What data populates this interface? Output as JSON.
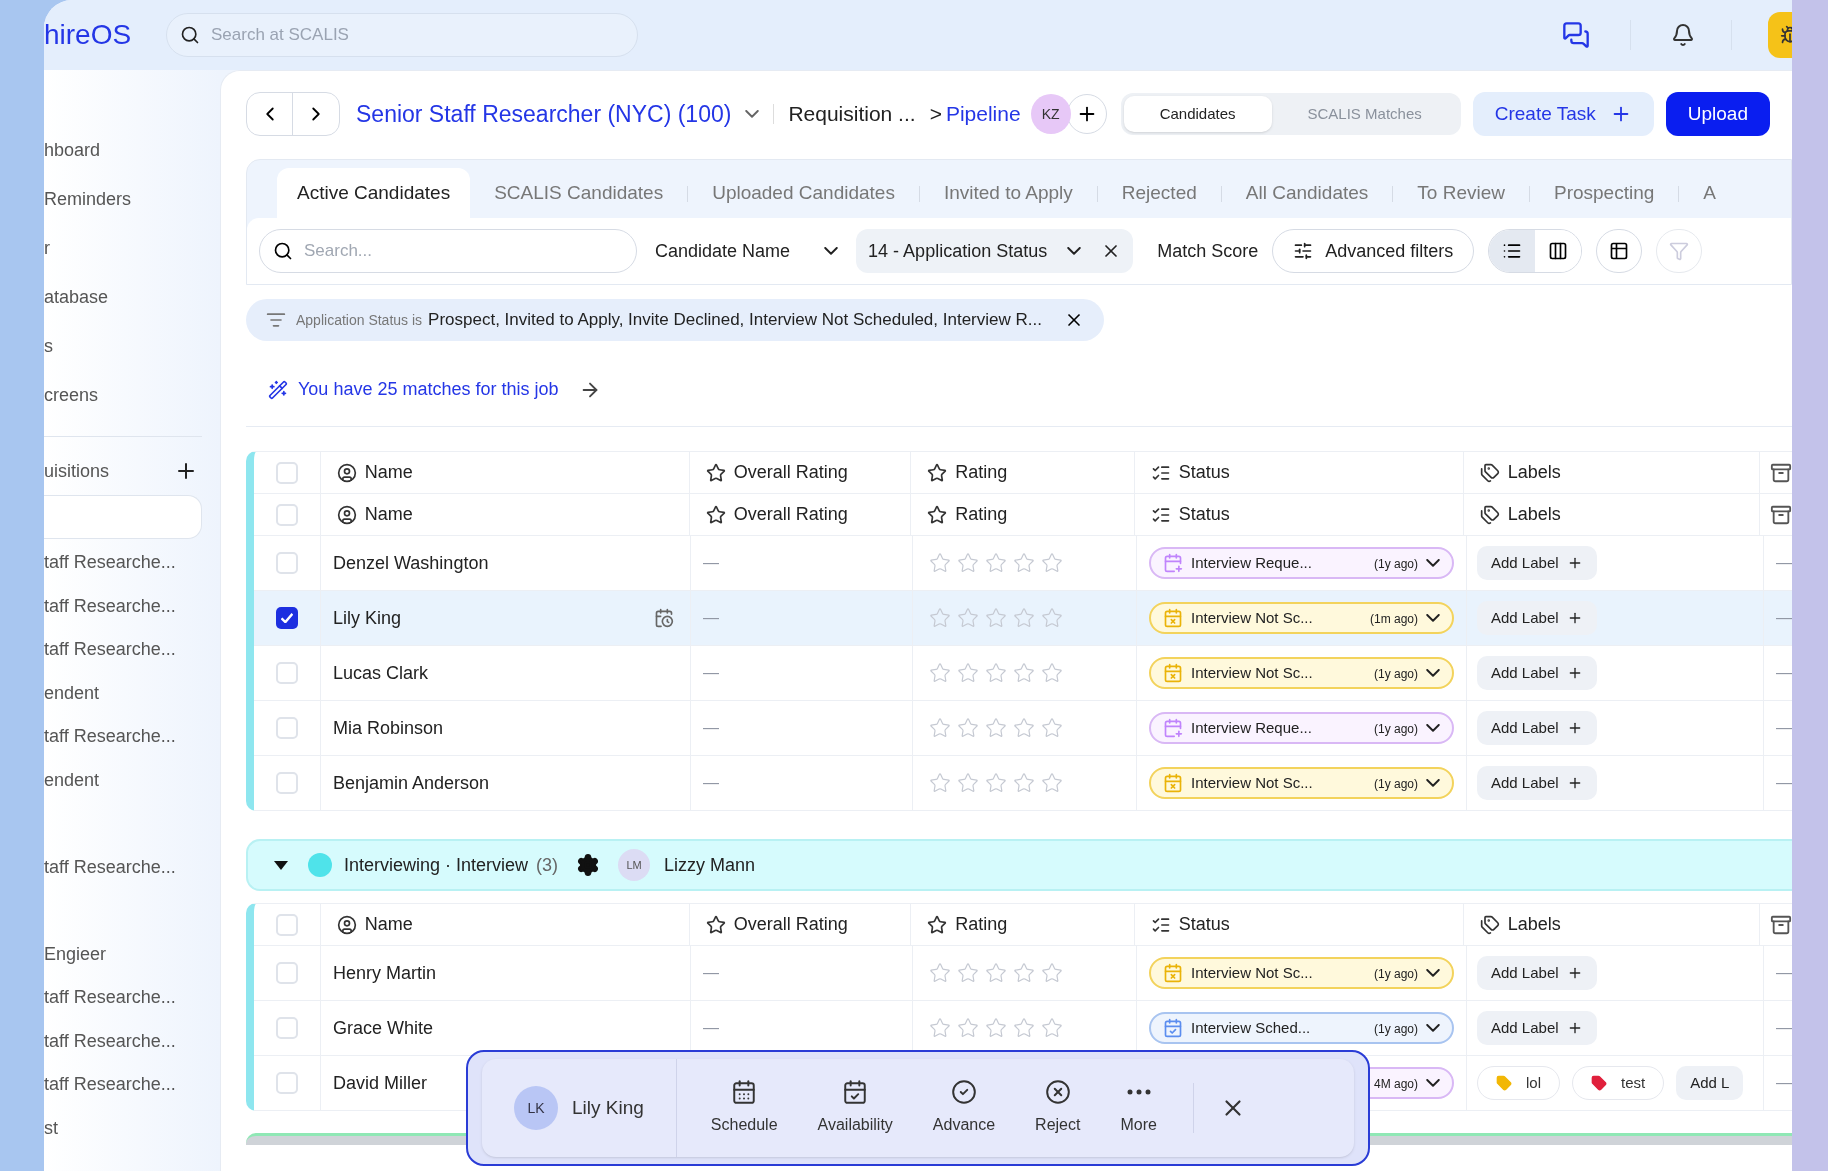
{
  "app": {
    "logo": "hireOS",
    "search_placeholder": "Search at SCALIS"
  },
  "sidebar": {
    "nav": [
      "hboard",
      "Reminders",
      "r",
      "atabase",
      "s",
      "creens"
    ],
    "requisitions_title": "uisitions",
    "requisitions": [
      {
        "label": "taff Researche...",
        "selected": false
      },
      {
        "label": "taff Researche...",
        "selected": false
      },
      {
        "label": "taff Researche...",
        "selected": false
      },
      {
        "label": "endent",
        "selected": false
      },
      {
        "label": "taff Researche...",
        "selected": false
      },
      {
        "label": "endent",
        "selected": false
      },
      {
        "selected": false
      },
      {
        "label": "taff Researche...",
        "selected": false
      },
      {
        "selected": false
      },
      {
        "label": "Engieer",
        "selected": false
      },
      {
        "label": "taff Researche...",
        "selected": false
      },
      {
        "label": "taff Researche...",
        "selected": false
      },
      {
        "label": "taff Researche...",
        "selected": false
      },
      {
        "label": "st",
        "selected": false
      }
    ]
  },
  "breadcrumb": {
    "job": "Senior Staff Researcher (NYC) (100)",
    "requisition": "Requisition ...",
    "separator": ">",
    "page": "Pipeline",
    "avatar": "KZ"
  },
  "view_toggle": [
    {
      "label": "Candidates",
      "selected": true
    },
    {
      "label": "SCALIS Matches",
      "selected": false
    }
  ],
  "create_task": "Create Task",
  "upload": "Upload",
  "tabs": [
    {
      "label": "Active Candidates",
      "selected": true
    },
    {
      "label": "SCALIS Candidates",
      "selected": false
    },
    {
      "label": "Uploaded Candidates",
      "selected": false
    },
    {
      "label": "Invited to Apply",
      "selected": false
    },
    {
      "label": "Rejected",
      "selected": false
    },
    {
      "label": "All Candidates",
      "selected": false
    },
    {
      "label": "To Review",
      "selected": false
    },
    {
      "label": "Prospecting",
      "selected": false
    },
    {
      "label": "A",
      "selected": false
    }
  ],
  "filters": {
    "search_placeholder": "Search...",
    "sort": "Candidate Name",
    "status_filter": "14 - Application Status",
    "match_score": "Match Score",
    "advanced": "Advanced filters",
    "layouts": [
      {
        "kind": "list",
        "selected": true
      },
      {
        "kind": "kanban",
        "selected": false
      }
    ]
  },
  "active_filter": {
    "field": "Application Status is",
    "values": "Prospect, Invited to Apply, Invite Declined, Interview Not Scheduled, Interview R..."
  },
  "matches_link": "You have 25 matches for this job",
  "sections": [
    {
      "header_rows": [
        {
          "checked": false,
          "labels": [
            "Name",
            "Overall Rating",
            "Rating",
            "Status",
            "Labels"
          ]
        },
        {
          "checked": false,
          "labels": [
            "Name",
            "Overall Rating",
            "Rating",
            "Status",
            "Labels"
          ]
        }
      ],
      "rows": [
        {
          "name": "Denzel Washington",
          "selected": false,
          "overall_rating": "—",
          "stars": 0,
          "status": {
            "kind": "requested",
            "label": "Interview Reque...",
            "age": "(1y ago)"
          },
          "labels": [],
          "add_label": "Add Label",
          "column_7": "—"
        },
        {
          "name": "Lily King",
          "selected": true,
          "overall_rating": "—",
          "stars": 0,
          "status": {
            "kind": "not_scheduled",
            "label": "Interview Not Sc...",
            "age": "(1m ago)"
          },
          "labels": [],
          "add_label": "Add Label",
          "column_7": "—"
        },
        {
          "name": "Lucas Clark",
          "selected": false,
          "overall_rating": "—",
          "stars": 0,
          "status": {
            "kind": "not_scheduled",
            "label": "Interview Not Sc...",
            "age": "(1y ago)"
          },
          "labels": [],
          "add_label": "Add Label",
          "column_7": "—"
        },
        {
          "name": "Mia Robinson",
          "selected": false,
          "overall_rating": "—",
          "stars": 0,
          "status": {
            "kind": "requested",
            "label": "Interview Reque...",
            "age": "(1y ago)"
          },
          "labels": [],
          "add_label": "Add Label",
          "column_7": "—"
        },
        {
          "name": "Benjamin Anderson",
          "selected": false,
          "overall_rating": "—",
          "stars": 0,
          "status": {
            "kind": "not_scheduled",
            "label": "Interview Not Sc...",
            "age": "(1y ago)"
          },
          "labels": [],
          "add_label": "Add Label",
          "column_7": "—"
        }
      ]
    },
    {
      "group": {
        "expanded": true,
        "color": "#4fe3ea",
        "title": "Interviewing · Interview",
        "count": "(3)",
        "owner_initials": "LM",
        "owner": "Lizzy Mann"
      },
      "header_rows": [
        {
          "checked": false,
          "labels": [
            "Name",
            "Overall Rating",
            "Rating",
            "Status",
            "Labels"
          ]
        }
      ],
      "rows": [
        {
          "name": "Henry Martin",
          "selected": false,
          "overall_rating": "—",
          "stars": 0,
          "status": {
            "kind": "not_scheduled",
            "label": "Interview Not Sc...",
            "age": "(1y ago)"
          },
          "labels": [],
          "add_label": "Add Label",
          "column_7": "—"
        },
        {
          "name": "Grace White",
          "selected": false,
          "overall_rating": "—",
          "stars": 0,
          "status": {
            "kind": "scheduled",
            "label": "Interview Sched...",
            "age": "(1y ago)"
          },
          "labels": [],
          "add_label": "Add Label",
          "column_7": "—"
        },
        {
          "name": "David Miller",
          "selected": false,
          "status": {
            "kind": "requested",
            "age": "4M ago)"
          },
          "labels": [
            {
              "text": "lol",
              "color": "#f2b705"
            },
            {
              "text": "test",
              "color": "#e0203c"
            }
          ],
          "add_label": "Add L",
          "column_7": "—"
        }
      ]
    }
  ],
  "action_bar": {
    "initials": "LK",
    "name": "Lily King",
    "actions": [
      {
        "kind": "schedule",
        "label": "Schedule"
      },
      {
        "kind": "availability",
        "label": "Availability"
      },
      {
        "kind": "advance",
        "label": "Advance"
      },
      {
        "kind": "reject",
        "label": "Reject"
      },
      {
        "kind": "more",
        "label": "More"
      }
    ]
  }
}
